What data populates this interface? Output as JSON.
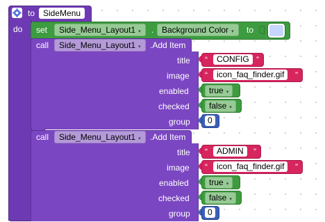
{
  "procedure": {
    "keyword": "to",
    "name": "SideMenu",
    "do_label": "do"
  },
  "set_block": {
    "keyword": "set",
    "component": "Side_Menu_Layout1",
    "dot": ".",
    "property": "Background Color",
    "to_label": "to",
    "color_value": "#c6d6ff"
  },
  "calls": [
    {
      "keyword": "call",
      "component": "Side_Menu_Layout1",
      "method": ".Add Item",
      "params": {
        "title_label": "title",
        "title_value": "CONFIG",
        "image_label": "image",
        "image_value": "icon_faq_finder.gif",
        "enabled_label": "enabled",
        "enabled_value": "true",
        "checked_label": "checked",
        "checked_value": "false",
        "group_label": "group",
        "group_value": "0"
      }
    },
    {
      "keyword": "call",
      "component": "Side_Menu_Layout1",
      "method": ".Add Item",
      "params": {
        "title_label": "title",
        "title_value": "ADMIN",
        "image_label": "image",
        "image_value": "icon_faq_finder.gif",
        "enabled_label": "enabled",
        "enabled_value": "true",
        "checked_label": "checked",
        "checked_value": "false",
        "group_label": "group",
        "group_value": "0"
      }
    }
  ],
  "glyphs": {
    "quote_open": "“",
    "quote_close": "”",
    "dropdown": "▾"
  },
  "colors": {
    "procedure": "#6e3ab4",
    "call": "#7b46c2",
    "setter": "#3d9b40",
    "text": "#d7255e",
    "logic": "#3d9b40",
    "math": "#3a5fb5"
  }
}
